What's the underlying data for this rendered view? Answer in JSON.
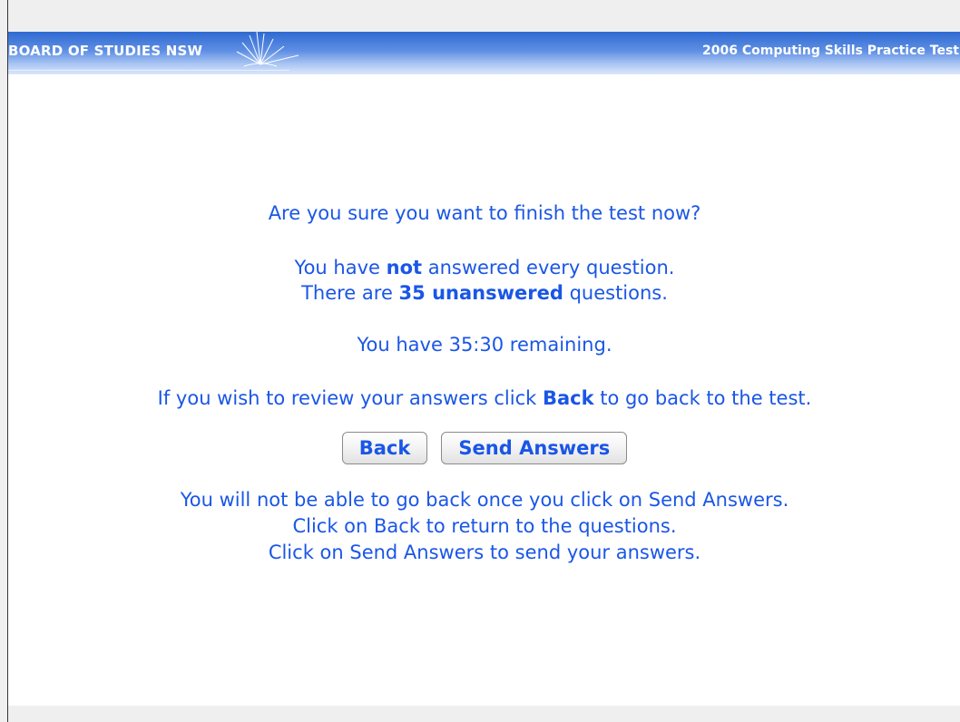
{
  "header": {
    "logo_text": "BOARD OF STUDIES NSW",
    "title": "2006 Computing Skills Practice Test"
  },
  "dialog": {
    "question": "Are you sure you want to finish the test now?",
    "status_line1_pre": "You have ",
    "status_line1_bold": "not",
    "status_line1_post": " answered every question.",
    "status_line2_pre": "There are ",
    "status_line2_bold": "35 unanswered",
    "status_line2_post": " questions.",
    "remaining_pre": "You have ",
    "remaining_time": "35:30",
    "remaining_post": " remaining.",
    "review_pre": "If you wish to review your answers click ",
    "review_bold": "Back",
    "review_post": " to go back to the test.",
    "back_button": "Back",
    "send_button": "Send Answers",
    "info_line1": "You will not be able to go back once you click on Send Answers.",
    "info_line2": "Click on Back to return to the questions.",
    "info_line3": "Click on Send Answers to send your answers."
  },
  "colors": {
    "text": "#1a56e6",
    "header_top": "#2f6ad1",
    "header_bottom": "#dbe7fb"
  }
}
